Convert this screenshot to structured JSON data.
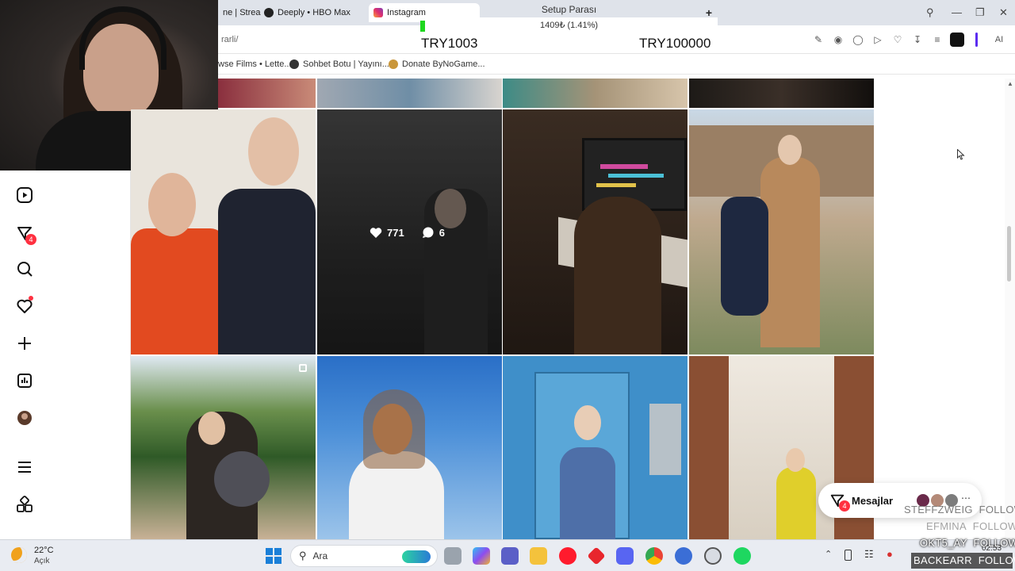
{
  "browser": {
    "tabs": [
      {
        "label": "ne | Strea",
        "icon": "stream-icon"
      },
      {
        "label": "Deeply • HBO Max",
        "icon": "hbo-icon"
      },
      {
        "label": "Instagram",
        "icon": "instagram-icon",
        "active": true
      }
    ],
    "url": "rarli/",
    "bookmarks": [
      {
        "label": "wse Films • Lette..."
      },
      {
        "label": "Sohbet Botu | Yayını..."
      },
      {
        "label": "Donate ByNoGame..."
      }
    ],
    "toolbar_ai_label": "AI"
  },
  "overlay": {
    "title": "Setup Parası",
    "progress_text": "1409₺ (1.41%)",
    "progress_fraction": 0.0141,
    "current": "TRY1003",
    "goal": "TRY100000",
    "fill_color": "#1ed71e"
  },
  "sidebar": {
    "items": [
      {
        "name": "reels-icon"
      },
      {
        "name": "messages-icon",
        "badge": "4"
      },
      {
        "name": "search-icon"
      },
      {
        "name": "notifications-icon",
        "dot": true
      },
      {
        "name": "create-icon"
      },
      {
        "name": "dashboard-icon"
      },
      {
        "name": "profile-avatar"
      },
      {
        "name": "menu-icon"
      },
      {
        "name": "more-apps-icon"
      }
    ]
  },
  "post_hover": {
    "likes": "771",
    "comments": "6"
  },
  "messages_pill": {
    "label": "Mesajlar",
    "badge": "4"
  },
  "follows": [
    {
      "name": "STEFFZWEIG",
      "action": "FOLLOW"
    },
    {
      "name": "EFMINA",
      "action": "FOLLOW"
    },
    {
      "name": "OKT5_AY",
      "action": "FOLLOW"
    },
    {
      "name": "BACKEARR",
      "action": "FOLLOW"
    }
  ],
  "taskbar": {
    "weather_temp": "22°C",
    "weather_desc": "Açık",
    "search_placeholder": "Ara",
    "clock": "02:53"
  },
  "colors": {
    "notification_red": "#ff3040",
    "instagram_pink": "#e1306c"
  }
}
